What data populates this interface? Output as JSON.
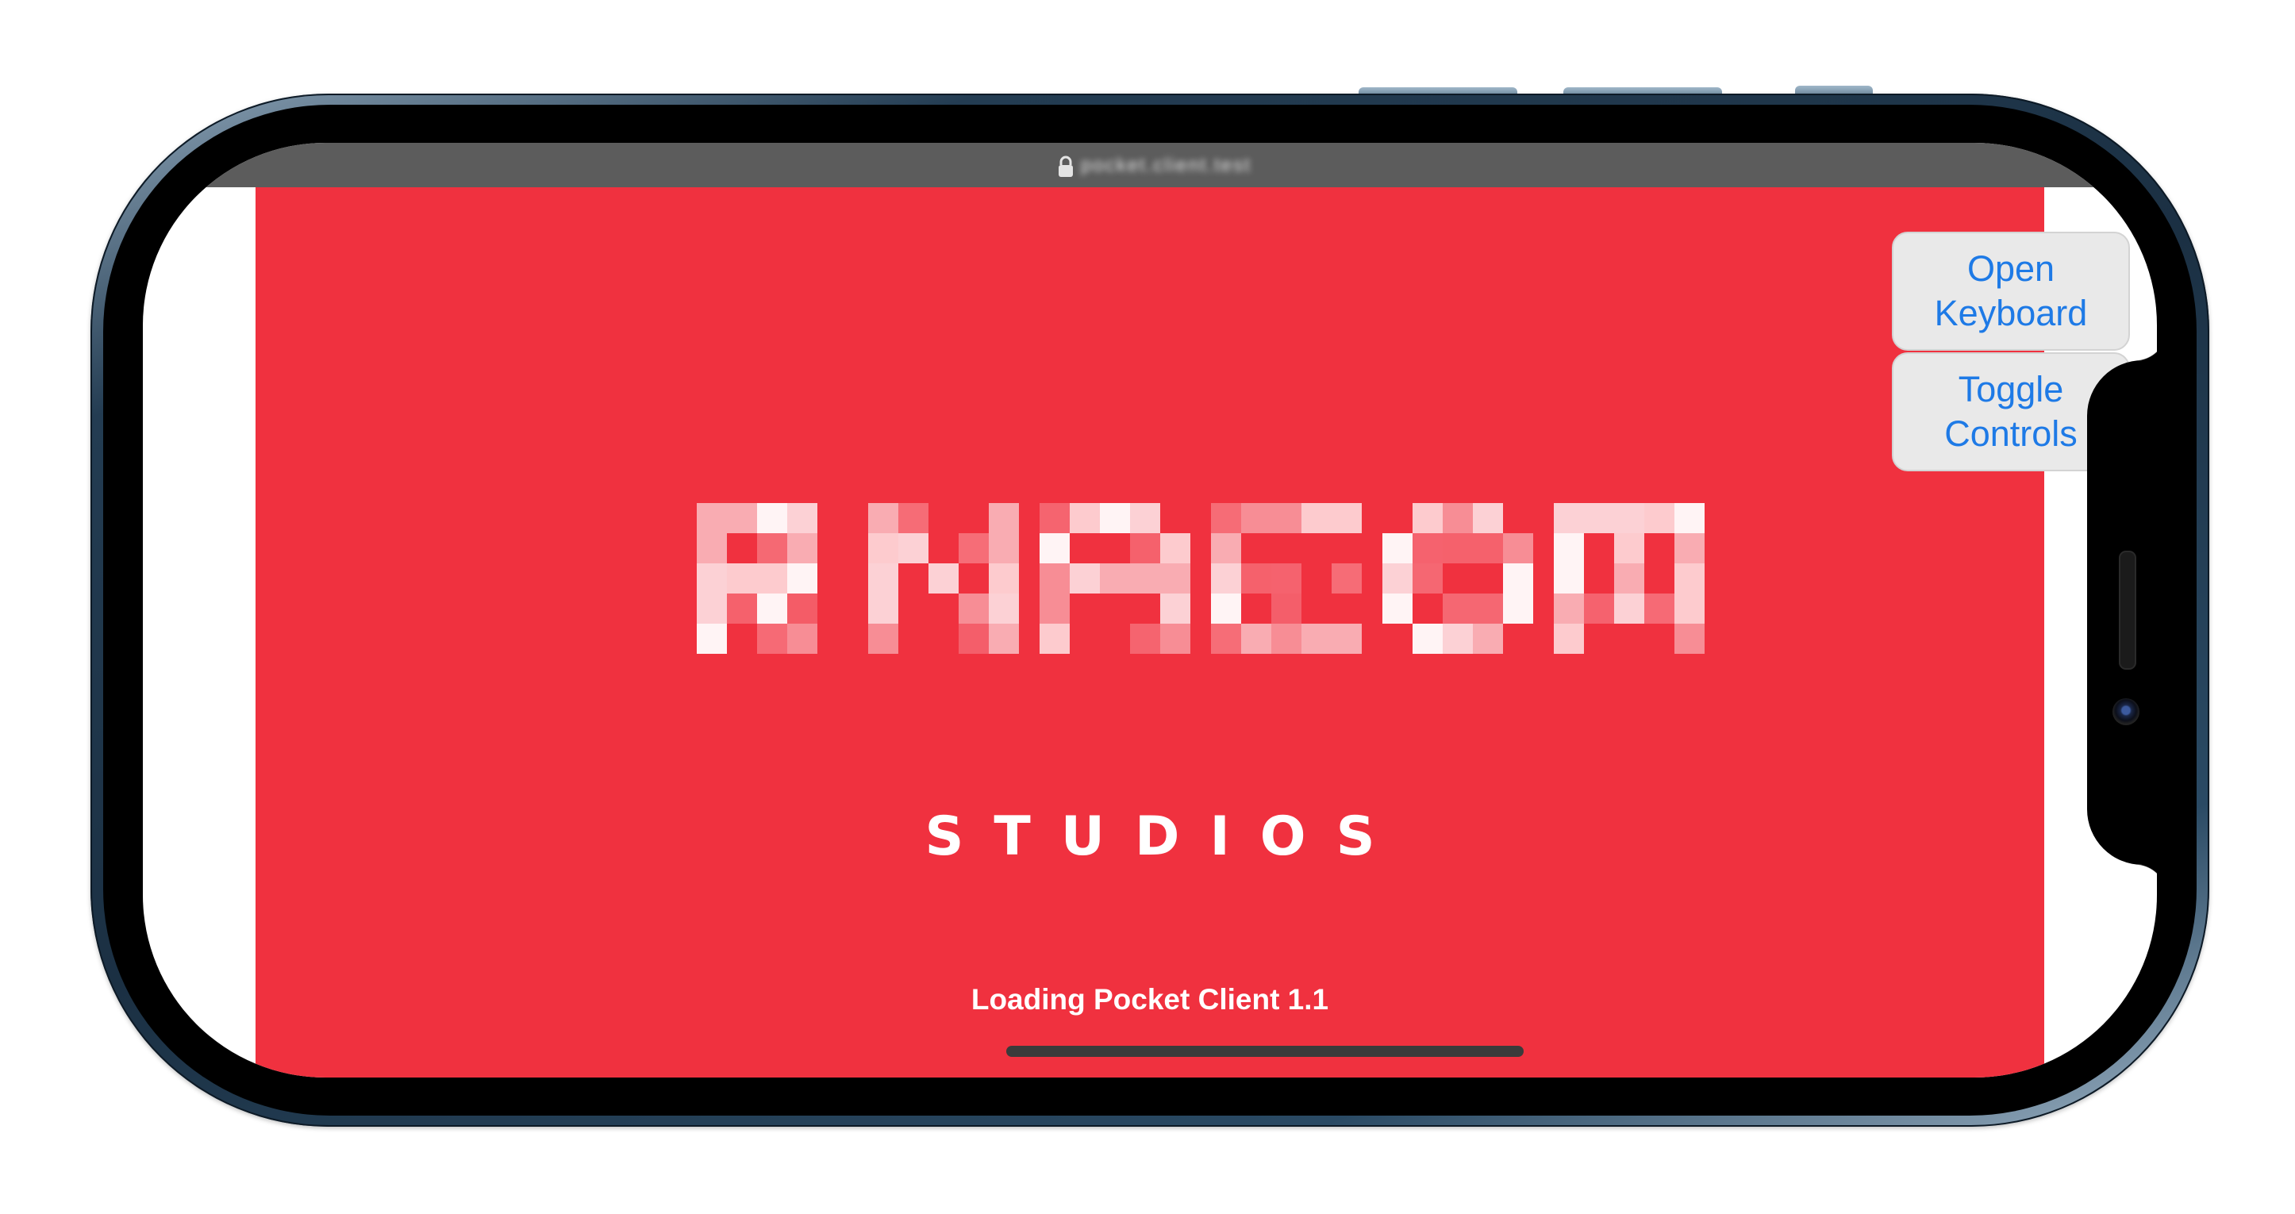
{
  "browser": {
    "url_text": "pocket.client.test",
    "lock_icon": "lock-icon"
  },
  "game": {
    "background_color": "#f0313f",
    "logo_name": "RNACOM",
    "logo_subtitle": "STUDIOS",
    "loading_text": "Loading Pocket Client 1.1"
  },
  "overlay_buttons": {
    "open_keyboard": "Open Keyboard",
    "toggle_controls": "Toggle Controls"
  },
  "colors": {
    "button_text": "#1e7ae6",
    "button_bg": "#e9e9e9",
    "url_bar": "#5c5c5c"
  }
}
